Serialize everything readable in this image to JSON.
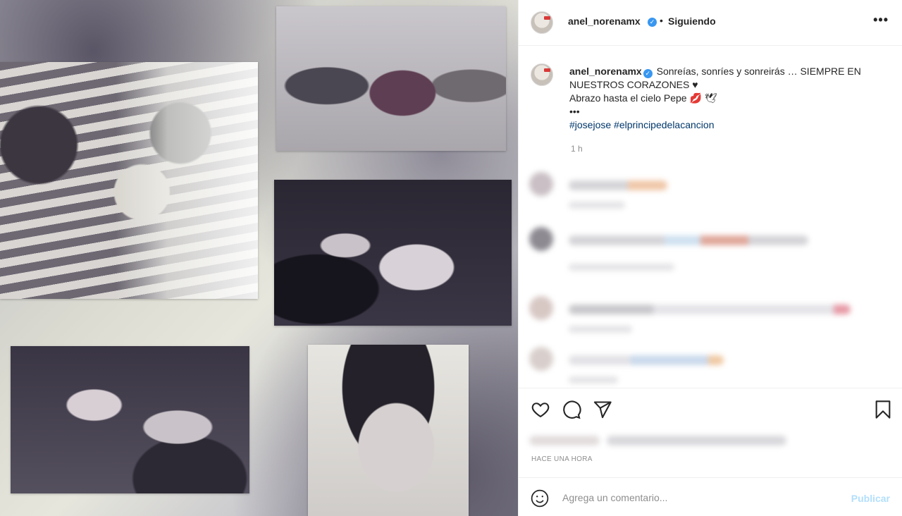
{
  "post": {
    "username": "anel_norenamx",
    "verified_mark": "✓",
    "separator": "•",
    "follow_status": "Siguiendo",
    "more_glyph": "•••"
  },
  "caption": {
    "username": "anel_norenamx",
    "line1": "Sonreías, sonríes y sonreirás … SIEMPRE EN NUESTROS CORAZONES ♥",
    "line2": "Abrazo hasta el cielo Pepe 💋 🕊",
    "expand": "•••",
    "hashtags": "#josejose #elprincipedelacancion",
    "time": "1 h"
  },
  "engagement": {
    "posted_label": "HACE UNA HORA"
  },
  "comment_box": {
    "placeholder": "Agrega un comentario...",
    "publish_label": "Publicar"
  },
  "icons": {
    "like": "heart-icon",
    "comment": "comment-icon",
    "share": "share-icon",
    "save": "bookmark-icon",
    "emoji": "emoji-icon"
  },
  "colors": {
    "link": "#00376b",
    "verified": "#3897f0",
    "publish_disabled": "#b2dffc",
    "muted": "#8e8e8e"
  }
}
